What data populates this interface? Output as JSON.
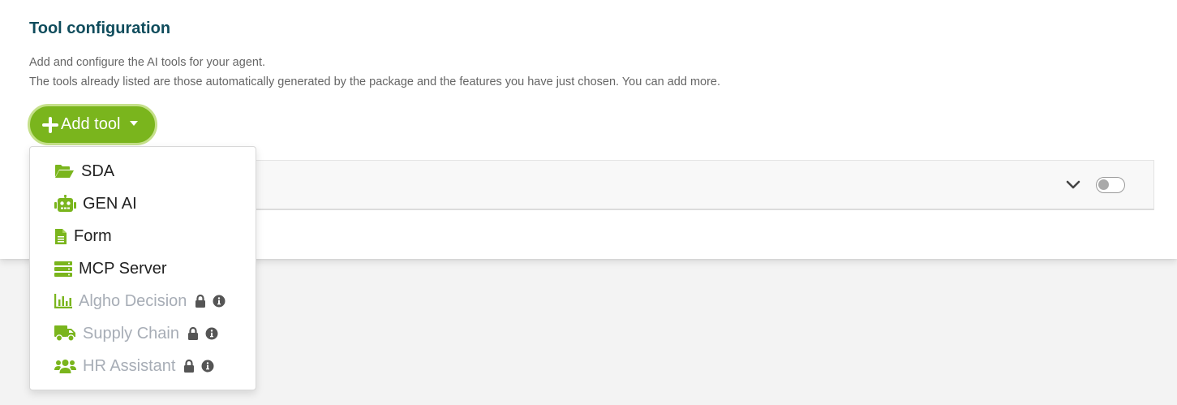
{
  "section": {
    "title": "Tool configuration",
    "description_line1": "Add and configure the AI tools for your agent.",
    "description_line2": "The tools already listed are those automatically generated by the package and the features you have just chosen. You can add more."
  },
  "add_tool_button": {
    "label": "Add tool",
    "icon": "plus-icon"
  },
  "menu": {
    "items": [
      {
        "label": "SDA",
        "icon": "folder-open-icon",
        "disabled": false
      },
      {
        "label": "GEN AI",
        "icon": "robot-icon",
        "disabled": false
      },
      {
        "label": "Form",
        "icon": "file-icon",
        "disabled": false
      },
      {
        "label": "MCP Server",
        "icon": "server-icon",
        "disabled": false
      },
      {
        "label": "Algho Decision",
        "icon": "chart-bar-icon",
        "disabled": true
      },
      {
        "label": "Supply Chain",
        "icon": "truck-icon",
        "disabled": true
      },
      {
        "label": "HR Assistant",
        "icon": "users-icon",
        "disabled": true
      }
    ]
  },
  "colors": {
    "accent": "#7ab51d",
    "title": "#0f4c5c",
    "disabled_text": "#a7adb6",
    "lock_info_icons": "#555555"
  },
  "tool_row": {
    "enabled": false
  }
}
